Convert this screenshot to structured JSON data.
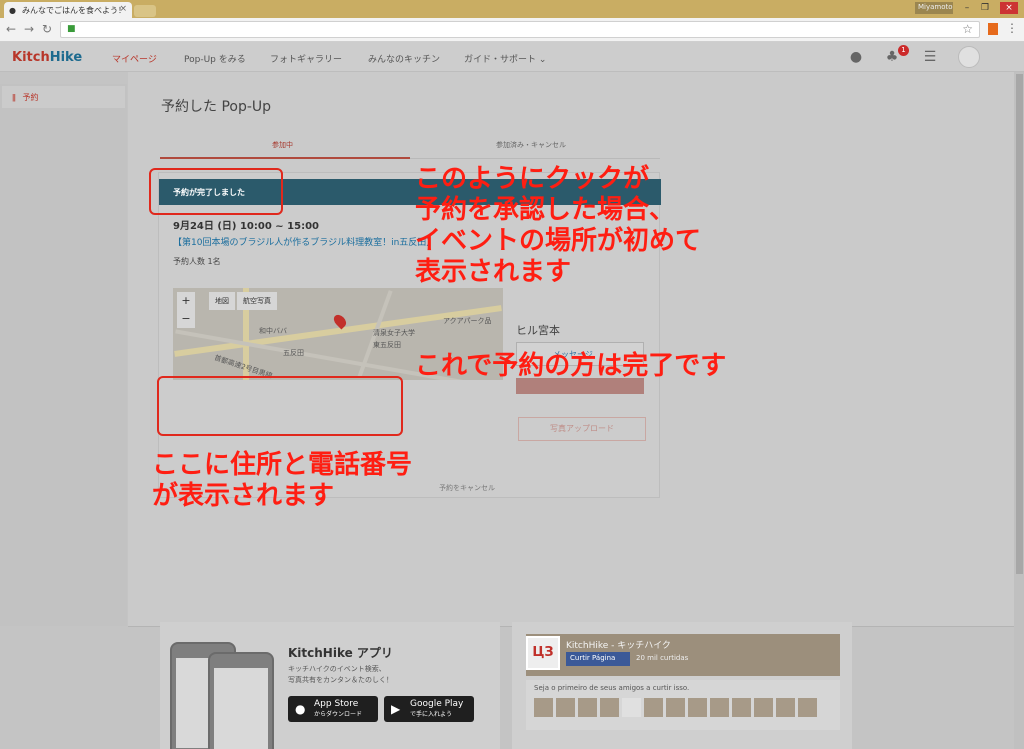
{
  "browser": {
    "tab_title": "みんなでごはんを食べよう！",
    "user_badge": "Miyamoto",
    "colors": {
      "titlebar": "#c9ad63"
    }
  },
  "site": {
    "logo_kitch": "Kitch",
    "logo_hike": "Hike",
    "nav": [
      "マイページ",
      "Pop-Up をみる",
      "フォトギャラリー",
      "みんなのキッチン",
      "ガイド・サポート"
    ],
    "notification_count": "1"
  },
  "sidebar": {
    "items": [
      {
        "label": "予約",
        "icon": "fork-knife-icon"
      }
    ]
  },
  "main": {
    "page_title": "予約した Pop-Up",
    "tabs": [
      "参加中",
      "参加済み・キャンセル"
    ],
    "card": {
      "status": "予約が完了しました",
      "date": "9月24日 (日) 10:00 ~ 15:00",
      "event_title": "【第10回本場のブラジル人が作るブラジル料理教室！in五反田】",
      "reservation_count": "予約人数 1名",
      "map": {
        "type_buttons": [
          "地図",
          "航空写真"
        ],
        "labels": [
          "和中ババ",
          "アクアパーク品",
          "清泉女子大学",
          "東五反田",
          "五反田",
          "首都高速2号目黒線"
        ]
      },
      "cancel": "予約をキャンセル",
      "host_name": "ヒル宮本",
      "message_button": "メッセージ",
      "photo_button": "写真アップロード"
    }
  },
  "footer": {
    "app": {
      "title": "KitchHike アプリ",
      "desc_line1": "キッチハイクのイベント検索、",
      "desc_line2": "写真共有をカンタン＆たのしく！",
      "appstore_big": "App Store",
      "appstore_small": "からダウンロード",
      "gplay_big": "Google Play",
      "gplay_small": "で手に入れよう"
    },
    "facebook": {
      "page_name": "KitchHike - キッチハイク",
      "like_button": "Curtir Página",
      "like_count": "20 mil curtidas",
      "friends_text": "Seja o primeiro de seus amigos a curtir isso."
    }
  },
  "annotations": {
    "main_lines": [
      "このようにクックが",
      "予約を承認した場合、",
      "イベントの場所が初めて",
      "表示されます"
    ],
    "done": "これで予約の方は完了です",
    "address_lines": [
      "ここに住所と電話番号",
      "が表示されます"
    ]
  }
}
